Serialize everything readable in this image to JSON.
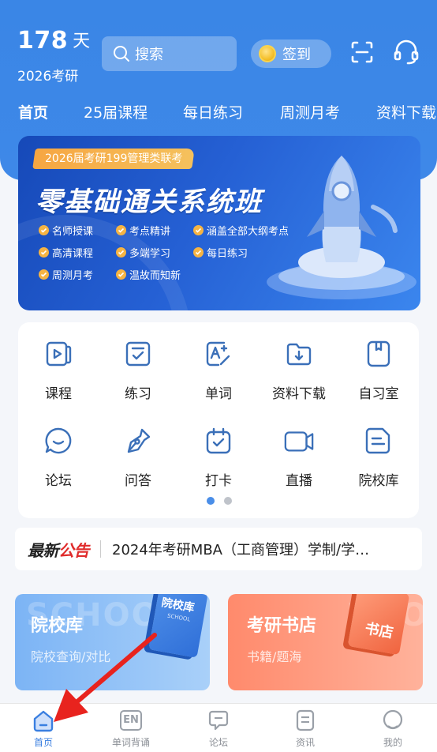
{
  "header": {
    "countdown_number": "178",
    "countdown_unit": "天",
    "subtitle": "2026考研",
    "search_placeholder": "搜索",
    "signin_label": "签到",
    "scan_icon": "scan-icon",
    "service_icon": "headset-icon"
  },
  "tabs": [
    {
      "label": "首页",
      "active": true
    },
    {
      "label": "25届课程"
    },
    {
      "label": "每日练习"
    },
    {
      "label": "周测月考"
    },
    {
      "label": "资料下载"
    }
  ],
  "banner": {
    "tag": "2026届考研199管理类联考",
    "title": "零基础通关系统班",
    "features": [
      "名师授课",
      "考点精讲",
      "涵盖全部大纲考点",
      "高清课程",
      "多端学习",
      "每日练习",
      "周测月考",
      "温故而知新"
    ]
  },
  "grid": [
    {
      "label": "课程",
      "icon": "video-course-icon"
    },
    {
      "label": "练习",
      "icon": "practice-check-icon"
    },
    {
      "label": "单词",
      "icon": "word-edit-icon"
    },
    {
      "label": "资料下载",
      "icon": "folder-download-icon"
    },
    {
      "label": "自习室",
      "icon": "bookmark-room-icon"
    },
    {
      "label": "论坛",
      "icon": "chat-bubble-icon"
    },
    {
      "label": "问答",
      "icon": "pen-nib-icon"
    },
    {
      "label": "打卡",
      "icon": "calendar-check-icon"
    },
    {
      "label": "直播",
      "icon": "video-camera-icon"
    },
    {
      "label": "院校库",
      "icon": "document-list-icon"
    }
  ],
  "notice": {
    "logo_part1": "最新",
    "logo_part2": "公告",
    "text": "2024年考研MBA（工商管理）学制/学…"
  },
  "promos": [
    {
      "title": "院校库",
      "subtitle": "院校查询/对比",
      "bg_text": "SCHOOL",
      "book_label": "院校库",
      "book_sub": "SCHOOL"
    },
    {
      "title": "考研书店",
      "subtitle": "书籍/题海",
      "bg_text": "BOOK",
      "book_label": "书店"
    }
  ],
  "tabbar": [
    {
      "label": "首页",
      "icon": "home-icon",
      "active": true
    },
    {
      "label": "单词背诵",
      "icon": "en-icon",
      "glyph": "EN"
    },
    {
      "label": "论坛",
      "icon": "message-icon"
    },
    {
      "label": "资讯",
      "icon": "news-icon"
    },
    {
      "label": "我的",
      "icon": "profile-icon"
    }
  ],
  "colors": {
    "primary": "#3a86e6",
    "accent_orange": "#f6a642",
    "notice_red": "#e02b2b",
    "icon_blue": "#3a6fb8"
  }
}
